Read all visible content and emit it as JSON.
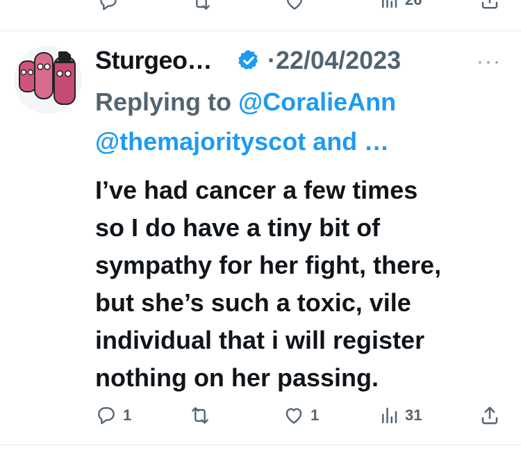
{
  "top_actions": {
    "views_count": "26"
  },
  "tweet": {
    "display_name": "Sturgeo…",
    "date": "22/04/2023",
    "more": "···",
    "replying_prefix": "Replying to",
    "replying_user1": "@CoralieAnn",
    "replying_rest": "@themajorityscot and …",
    "body": {
      "l1_pre": "I’ve had ",
      "l1_bold": "cancer",
      "l1_post": " a few times",
      "l2": "so I do have a tiny bit of",
      "l3": "sympathy for her fight, there,",
      "l4": "but she’s such a toxic, vile",
      "l5": "individual that i will register",
      "l6": "nothing on her passing."
    },
    "actions": {
      "replies": "1",
      "retweets": "",
      "likes": "1",
      "views": "31"
    }
  },
  "colors": {
    "link": "#1d9bf0",
    "muted": "#536471",
    "verified": "#1d9bf0",
    "avatar_pink": "#d0547a"
  },
  "icons": [
    "reply-icon",
    "retweet-icon",
    "like-icon",
    "views-icon",
    "share-icon",
    "verified-badge-icon",
    "more-icon"
  ]
}
